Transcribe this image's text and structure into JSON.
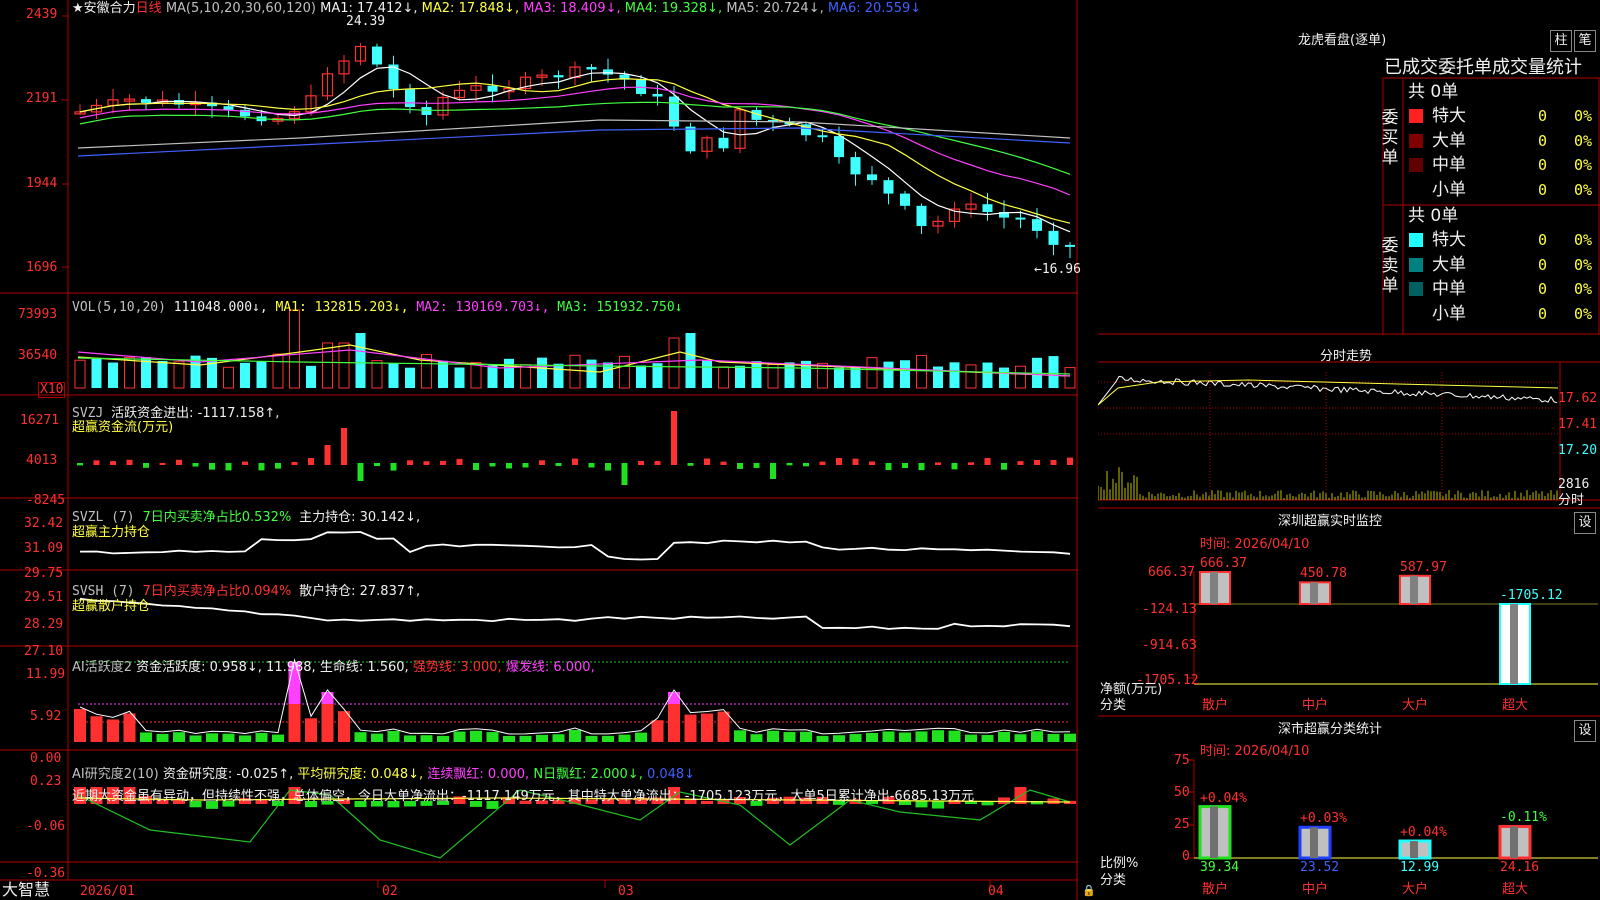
{
  "app": {
    "brand": "大智慧",
    "stock_title": "★安徽合力",
    "period": "日线"
  },
  "colors": {
    "up": "#ff3030",
    "down": "#40ffff",
    "ma1": "#ffffff",
    "ma2": "#ffff40",
    "ma3": "#ff40ff",
    "ma4": "#40ff40",
    "ma5": "#c0c0c0",
    "ma6": "#4060ff",
    "grid": "#b00000"
  },
  "price_panel": {
    "ma_params": "MA(5,10,20,30,60,120)",
    "ma1": "MA1: 17.412↓,",
    "ma2": "MA2: 17.848↓,",
    "ma3": "MA3: 18.409↓,",
    "ma4": "MA4: 19.328↓,",
    "ma5": "MA5: 20.724↓,",
    "ma6": "MA6: 20.559↓",
    "yticks": [
      "2439",
      "2191",
      "1944",
      "1696"
    ],
    "high_label": "24.39",
    "low_label": "←16.96"
  },
  "vol_panel": {
    "title": "VOL(5,10,20)",
    "value": "111048.000↓,",
    "ma1": "MA1: 132815.203↓,",
    "ma2": "MA2: 130169.703↓,",
    "ma3": "MA3: 151932.750↓",
    "yticks": [
      "73993",
      "36540"
    ],
    "unit": "X10"
  },
  "svzj_panel": {
    "title": "SVZJ",
    "label": "活跃资金进出: -1117.158↑,",
    "sub": "超赢资金流(万元)",
    "yticks": [
      "16271",
      "4013",
      "-8245"
    ]
  },
  "svzl_panel": {
    "title": "SVZL (7)",
    "ratio": "7日内买卖净占比0.532%",
    "hold": "主力持仓: 30.142↓,",
    "sub": "超赢主力持仓",
    "yticks": [
      "32.42",
      "31.09",
      "29.75"
    ]
  },
  "svsh_panel": {
    "title": "SVSH (7)",
    "ratio": "7日内买卖净占比0.094%",
    "hold": "散户持仓: 27.837↑,",
    "sub": "超赢散户持仓",
    "yticks": [
      "29.51",
      "28.29",
      "27.10"
    ]
  },
  "ai_active_panel": {
    "title": "AI活跃度2",
    "degree": "资金活跃度: 0.958↓,",
    "val2": "11.988,",
    "life": "生命线: 1.560,",
    "strong": "强势线: 3.000,",
    "burst": "爆发线: 6.000,",
    "yticks": [
      "11.99",
      "5.92",
      "0.00"
    ]
  },
  "ai_research_panel": {
    "title": "AI研究度2(10)",
    "degree": "资金研究度: -0.025↑,",
    "avg": "平均研究度: 0.048↓,",
    "cont": "连续飘红: 0.000,",
    "nday": "N日飘红: 2.000↓,",
    "last": "0.048↓",
    "comment": "近期大资金虽有异动，但持续性不强，总体偏空，今日大单净流出：-1117.149万元，其中特大单净流出：-1705.123万元，大单5日累计净出-6685.13万元",
    "yticks": [
      "0.23",
      "-0.06",
      "-0.36"
    ]
  },
  "x_axis": [
    "2026/01",
    "02",
    "03",
    "04"
  ],
  "right": {
    "lhb_title": "龙虎看盘(逐单)",
    "btn_zhu": "柱",
    "btn_bi": "笔",
    "order_title": "已成交委托单成交量统计",
    "buy_label": "委买单",
    "sell_label": "委卖单",
    "buy_total": "共 0单",
    "sell_total": "共 0单",
    "buy_rows": [
      {
        "name": "特大",
        "count": "0",
        "pct": "0%",
        "color": "#ff2020"
      },
      {
        "name": "大单",
        "count": "0",
        "pct": "0%",
        "color": "#800000"
      },
      {
        "name": "中单",
        "count": "0",
        "pct": "0%",
        "color": "#600000"
      },
      {
        "name": "小单",
        "count": "0",
        "pct": "0%",
        "color": ""
      }
    ],
    "sell_rows": [
      {
        "name": "特大",
        "count": "0",
        "pct": "0%",
        "color": "#20ffff"
      },
      {
        "name": "大单",
        "count": "0",
        "pct": "0%",
        "color": "#008080"
      },
      {
        "name": "中单",
        "count": "0",
        "pct": "0%",
        "color": "#006060"
      },
      {
        "name": "小单",
        "count": "0",
        "pct": "0%",
        "color": ""
      }
    ],
    "intraday_title": "分时走势",
    "intraday_yticks": [
      "17.62",
      "17.41",
      "17.20"
    ],
    "intraday_vol_top": "2816",
    "intraday_vol_unit": "分时",
    "monitor_title": "深圳超赢实时监控",
    "monitor_set": "设",
    "monitor_time": "时间: 2026/04/10",
    "monitor_yticks": [
      "666.37",
      "-124.13",
      "-914.63",
      "-1705.12"
    ],
    "monitor_ylabel": "净额(万元)",
    "monitor_xlabel": "分类",
    "monitor_bars": [
      {
        "name": "散户",
        "value": 666.37,
        "label": "666.37"
      },
      {
        "name": "中户",
        "value": 450.78,
        "label": "450.78"
      },
      {
        "name": "大户",
        "value": 587.97,
        "label": "587.97"
      },
      {
        "name": "超大",
        "value": -1705.12,
        "label": "-1705.12"
      }
    ],
    "class_title": "深市超赢分类统计",
    "class_set": "设",
    "class_time": "时间: 2026/04/10",
    "class_yticks": [
      "75",
      "50",
      "25",
      "0"
    ],
    "class_ylabel": "比例%",
    "class_xlabel": "分类",
    "class_bars": [
      {
        "name": "散户",
        "value": 39.34,
        "label": "39.34",
        "delta": "+0.04%"
      },
      {
        "name": "中户",
        "value": 23.52,
        "label": "23.52",
        "delta": "+0.03%"
      },
      {
        "name": "大户",
        "value": 12.99,
        "label": "12.99",
        "delta": "+0.04%"
      },
      {
        "name": "超大",
        "value": 24.16,
        "label": "24.16",
        "delta": "-0.11%"
      }
    ]
  },
  "chart_data": [
    {
      "type": "bar",
      "title": "深圳超赢实时监控",
      "ylabel": "净额(万元)",
      "xlabel": "分类",
      "categories": [
        "散户",
        "中户",
        "大户",
        "超大"
      ],
      "values": [
        666.37,
        450.78,
        587.97,
        -1705.12
      ],
      "ylim": [
        -1705.12,
        666.37
      ]
    },
    {
      "type": "bar",
      "title": "深市超赢分类统计",
      "ylabel": "比例%",
      "xlabel": "分类",
      "categories": [
        "散户",
        "中户",
        "大户",
        "超大"
      ],
      "values": [
        39.34,
        23.52,
        12.99,
        24.16
      ],
      "ylim": [
        0,
        75
      ]
    }
  ]
}
